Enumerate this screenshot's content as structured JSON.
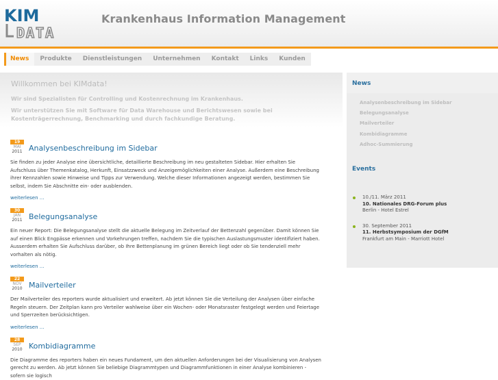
{
  "header": {
    "logo_text_top": "KIM",
    "logo_text_bottom": "DATA",
    "title": "Krankenhaus Information Management"
  },
  "nav": {
    "items": [
      {
        "label": "News",
        "active": true
      },
      {
        "label": "Produkte",
        "active": false
      },
      {
        "label": "Dienstleistungen",
        "active": false
      },
      {
        "label": "Unternehmen",
        "active": false
      },
      {
        "label": "Kontakt",
        "active": false
      },
      {
        "label": "Links",
        "active": false
      },
      {
        "label": "Kunden",
        "active": false
      }
    ]
  },
  "welcome": {
    "title": "Willkommen bei KIMdata!",
    "line1": "Wir sind Spezialisten für Controlling und Kostenrechnung im Krankenhaus.",
    "line2": "Wir unterstützen Sie mit Software für Data Warehouse und Berichtswesen sowie bei Kostenträgerrechnung, Benchmarking und durch fachkundige Beratung."
  },
  "articles": [
    {
      "day": "19",
      "month": "MAI",
      "year": "2011",
      "title": "Analysenbeschreibung im Sidebar",
      "body": "Sie finden zu jeder Analyse eine übersichtliche, detaillierte Beschreibung im neu gestalteten Sidebar. Hier erhalten Sie Aufschluss über Themenkatalog, Herkunft, Einsatzzweck und Anzeigemöglichkeiten einer Analyse. Außerdem eine Beschreibung ihrer Kennzahlen sowie Hinweise und Tipps zur Verwendung. Welche dieser Informationen angezeigt werden, bestimmen Sie selbst, indem Sie Abschnitte ein- oder ausblenden.",
      "more": "weiterlesen ..."
    },
    {
      "day": "30",
      "month": "JAN",
      "year": "2011",
      "title": "Belegungsanalyse",
      "body": "Ein neuer Report: Die Belegungsanalyse stellt die aktuelle Belegung im Zeitverlauf der Bettenzahl gegenüber. Damit können Sie auf einen Blick Engpässe erkennen und Vorkehrungen treffen, nachdem Sie die typischen Auslastungsmuster identifiziert haben. Ausserdem erhalten Sie Aufschluss darüber, ob Ihre Bettenplanung im grünen Bereich liegt oder ob Sie tendenziell mehr vorhalten als nötig.",
      "more": "weiterlesen ..."
    },
    {
      "day": "22",
      "month": "NOV",
      "year": "2010",
      "title": "Mailverteiler",
      "body": "Der Mailverteiler des reporters wurde aktualisiert und erweitert. Ab jetzt können Sie die Verteilung der Analysen über einfache Regeln steuern. Der Zeitplan kann pro Verteiler wahlweise über ein Wochen- oder Monatsraster festgelegt werden und Feiertage und Sperrzeiten berücksichtigen.",
      "more": "weiterlesen ..."
    },
    {
      "day": "28",
      "month": "SEP",
      "year": "2010",
      "title": "Kombidiagramme",
      "body": "Die Diagramme des reporters haben ein neues Fundament, um den aktuellen Anforderungen bei der Visualisierung von Analysen gerecht zu werden. Ab jetzt können Sie beliebige Diagrammtypen und Diagrammfunktionen in einer Analyse kombinieren - sofern sie logisch",
      "more": ""
    }
  ],
  "sidebar": {
    "news_title": "News",
    "news_links": [
      "Analysenbeschreibung im Sidebar",
      "Belegungsanalyse",
      "Mailverteiler",
      "Kombidiagramme",
      "Adhoc-Summierung"
    ],
    "events_title": "Events",
    "events": [
      {
        "date": "10./11. März 2011",
        "title": "10. Nationales DRG-Forum plus",
        "place": "Berlin - Hotel Estrel"
      },
      {
        "date": "30. September 2011",
        "title": "11. Herbstsymposium der DGfM",
        "place": "Frankfurt am Main - Marriott Hotel"
      }
    ]
  },
  "colors": {
    "accent": "#f39a1b",
    "link": "#1f6b9e",
    "bullet": "#8bb31d"
  }
}
